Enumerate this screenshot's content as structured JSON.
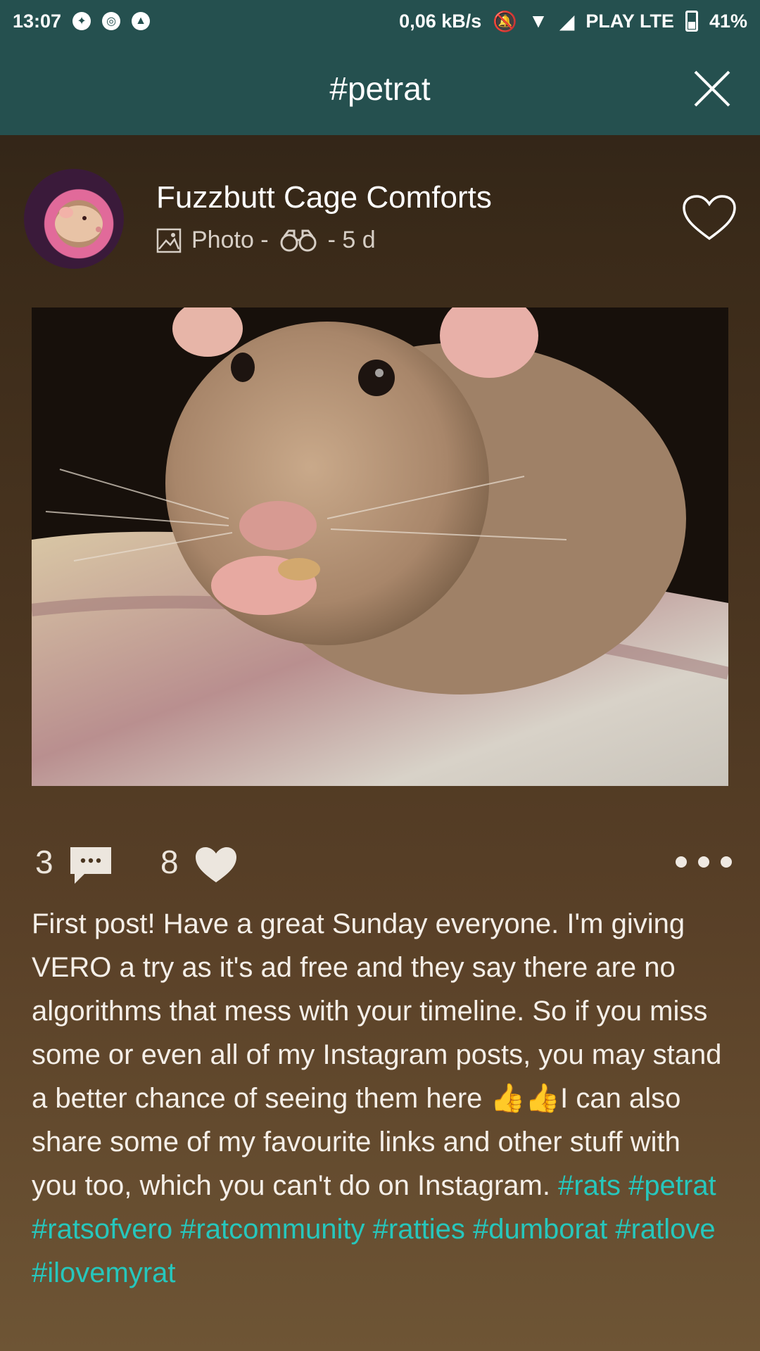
{
  "status_bar": {
    "time": "13:07",
    "net_speed": "0,06 kB/s",
    "carrier": "PLAY LTE",
    "battery": "41%"
  },
  "app_bar": {
    "title": "#petrat",
    "close_icon": "close-icon"
  },
  "post": {
    "author": "Fuzzbutt Cage Comforts",
    "type_label": "Photo -",
    "age": "- 5 d",
    "comments_count": "3",
    "likes_count": "8",
    "caption_text": "First post! Have a great Sunday everyone. I'm giving VERO a try as it's ad free and they say there are no algorithms that mess with your timeline. So if you miss some or even all of my Instagram posts, you may stand a better chance of seeing them here 👍👍I can also share some of my favourite links and other stuff with you too, which you can't do on Instagram.",
    "hashtags": [
      "#rats",
      "#petrat",
      "#ratsofvero",
      "#ratcommunity",
      "#ratties",
      "#dumborat",
      "#ratlove",
      "#ilovemyrat"
    ]
  },
  "colors": {
    "header_bg": "#25504f",
    "hashtag": "#26c7bd",
    "text": "#f5efe8"
  }
}
